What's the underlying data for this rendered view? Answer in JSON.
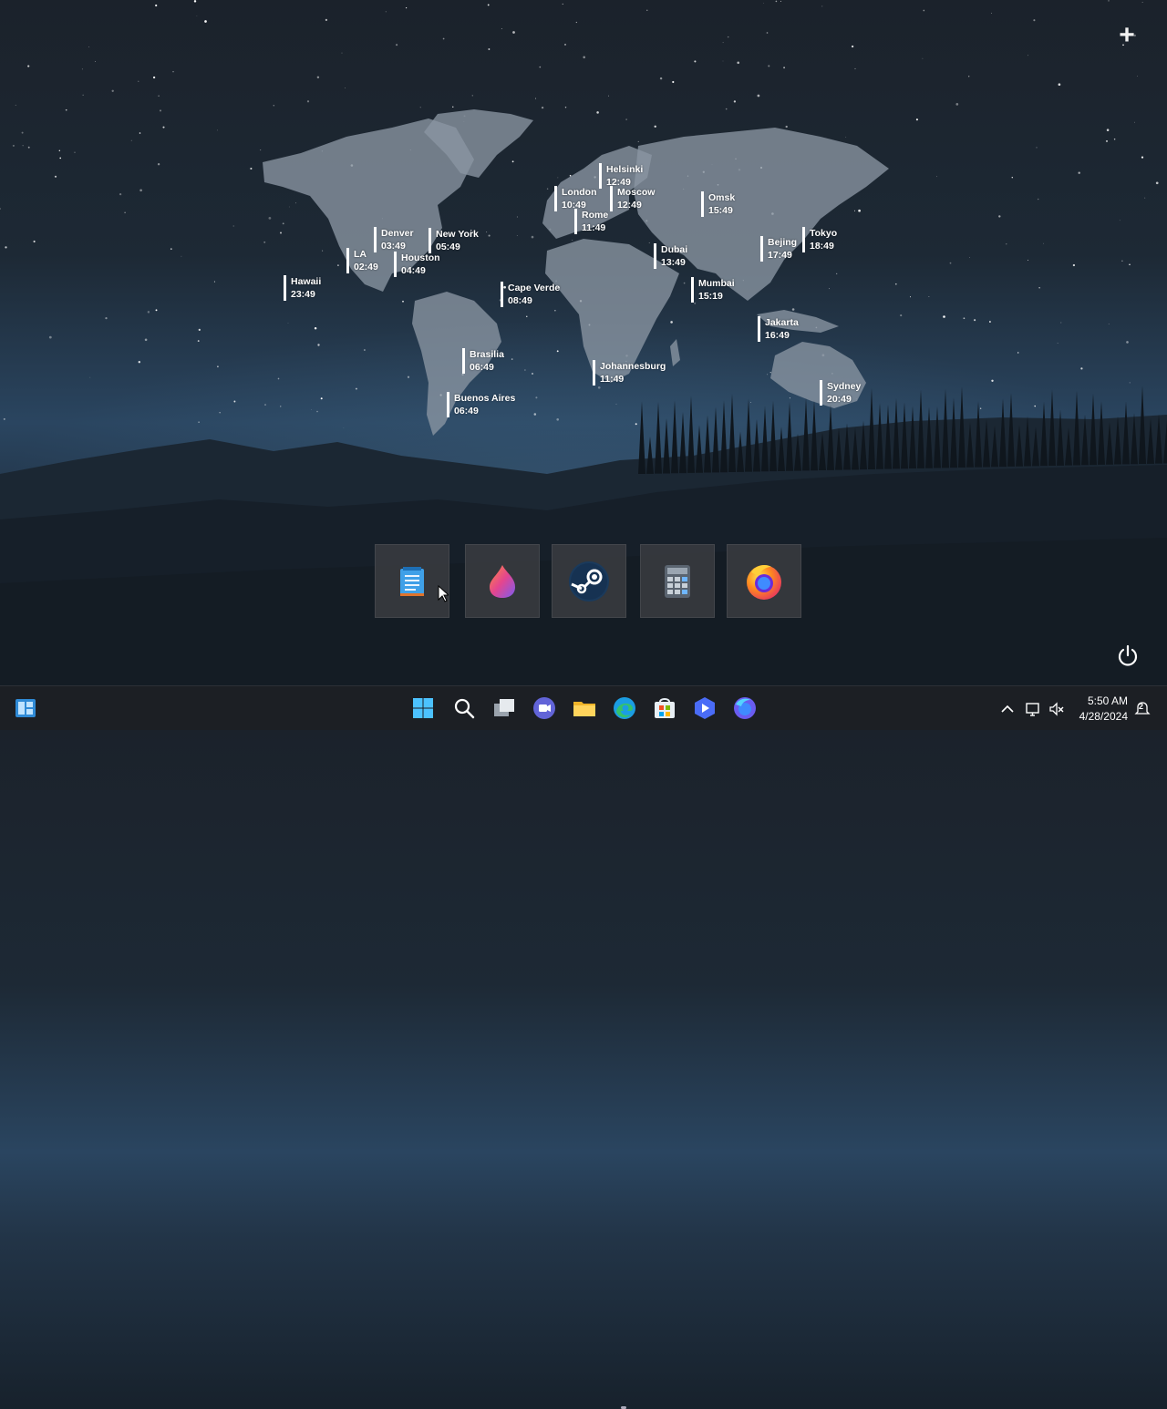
{
  "world_clocks": [
    {
      "city": "Helsinki",
      "time": "12:49"
    },
    {
      "city": "London",
      "time": "10:49"
    },
    {
      "city": "Moscow",
      "time": "12:49"
    },
    {
      "city": "Rome",
      "time": "11:49"
    },
    {
      "city": "Omsk",
      "time": "15:49"
    },
    {
      "city": "Denver",
      "time": "03:49"
    },
    {
      "city": "New York",
      "time": "05:49"
    },
    {
      "city": "LA",
      "time": "02:49"
    },
    {
      "city": "Houston",
      "time": "04:49"
    },
    {
      "city": "Hawaii",
      "time": "23:49"
    },
    {
      "city": "Tokyo",
      "time": "18:49"
    },
    {
      "city": "Bejing",
      "time": "17:49"
    },
    {
      "city": "Dubai",
      "time": "13:49"
    },
    {
      "city": "Mumbai",
      "time": "15:19"
    },
    {
      "city": "Cape Verde",
      "time": "08:49"
    },
    {
      "city": "Jakarta",
      "time": "16:49"
    },
    {
      "city": "Brasilia",
      "time": "06:49"
    },
    {
      "city": "Johannesburg",
      "time": "11:49"
    },
    {
      "city": "Sydney",
      "time": "20:49"
    },
    {
      "city": "Buenos Aires",
      "time": "06:49"
    }
  ],
  "desktop": {
    "add_label": "+",
    "launcher_tiles": [
      "notepad-icon",
      "affinity-icon",
      "steam-icon",
      "calculator-icon",
      "firefox-icon"
    ]
  },
  "taskbar": {
    "apps": [
      "start-icon",
      "search-icon",
      "task-view-icon",
      "teams-icon",
      "file-explorer-icon",
      "edge-icon",
      "store-icon",
      "clipchamp-icon",
      "firefox-icon"
    ],
    "tray": {
      "time": "5:50 AM",
      "date": "4/28/2024",
      "notification_count": "2"
    }
  },
  "colors": {
    "taskbar_bg": "#1c1f24",
    "tile_bg": "#373a3f",
    "map_fill": "#8a96a3"
  }
}
